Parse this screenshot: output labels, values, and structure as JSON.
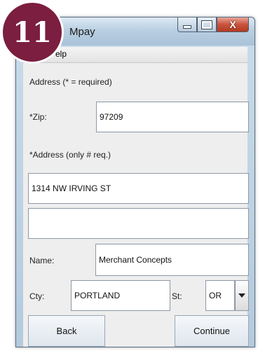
{
  "badge": {
    "number": "11"
  },
  "window": {
    "title": "Mpay",
    "close_glyph": "X"
  },
  "menu": {
    "help_label": "elp"
  },
  "form": {
    "section_label": "Address (* = required)",
    "zip_label": "*Zip:",
    "zip_value": "97209",
    "address_label": "*Address (only # req.)",
    "address1_value": "1314 NW IRVING ST",
    "address2_value": "",
    "name_label": "Name:",
    "name_value": "Merchant Concepts",
    "city_label": "Cty:",
    "city_value": "PORTLAND",
    "state_label": "St:",
    "state_value": "OR"
  },
  "buttons": {
    "back": "Back",
    "continue": "Continue"
  }
}
